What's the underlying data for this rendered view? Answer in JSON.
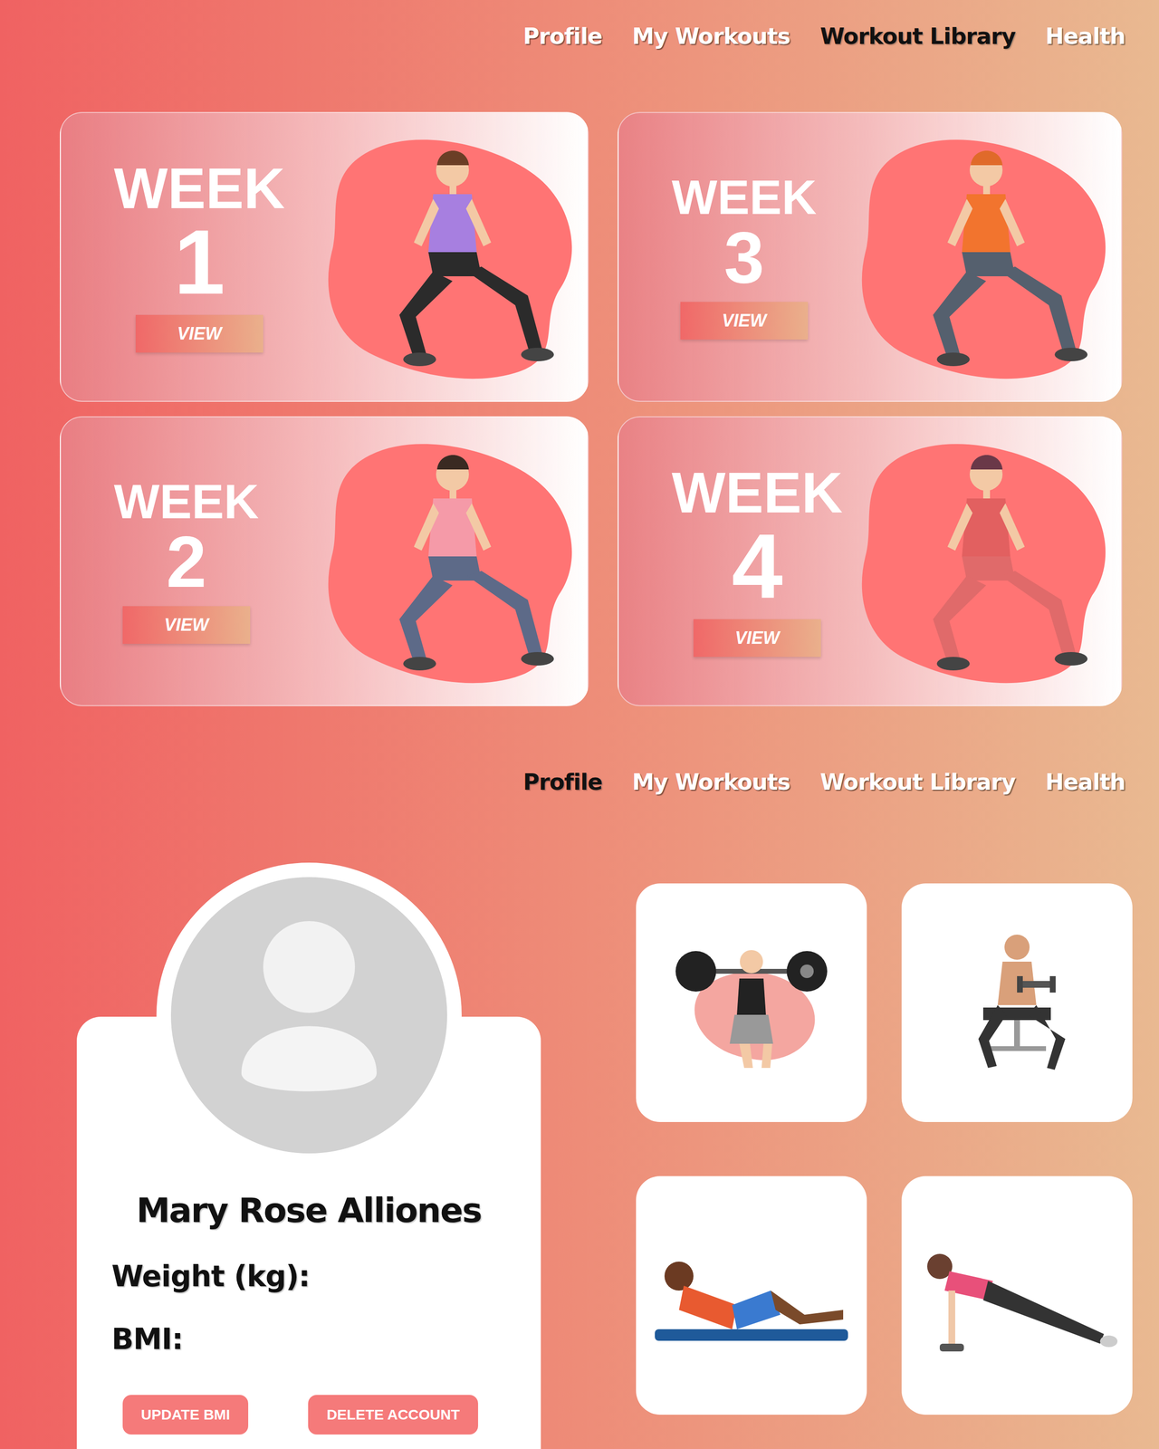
{
  "library_page": {
    "nav": [
      {
        "label": "Profile",
        "selected": false
      },
      {
        "label": "My Workouts",
        "selected": false
      },
      {
        "label": "Workout Library",
        "selected": true
      },
      {
        "label": "Health",
        "selected": false
      }
    ],
    "weeks": [
      {
        "title": "WEEK",
        "number": "1",
        "button": "VIEW"
      },
      {
        "title": "WEEK",
        "number": "3",
        "button": "VIEW"
      },
      {
        "title": "WEEK",
        "number": "2",
        "button": "VIEW"
      },
      {
        "title": "WEEK",
        "number": "4",
        "button": "VIEW"
      }
    ]
  },
  "profile_page": {
    "nav": [
      {
        "label": "Profile",
        "selected": true
      },
      {
        "label": "My Workouts",
        "selected": false
      },
      {
        "label": "Workout Library",
        "selected": false
      },
      {
        "label": "Health",
        "selected": false
      }
    ],
    "name": "Mary Rose Alliones",
    "fields": [
      {
        "label": "Weight (kg):"
      },
      {
        "label": "BMI:"
      }
    ],
    "buttons": [
      "UPDATE BMI",
      "DELETE ACCOUNT"
    ]
  }
}
